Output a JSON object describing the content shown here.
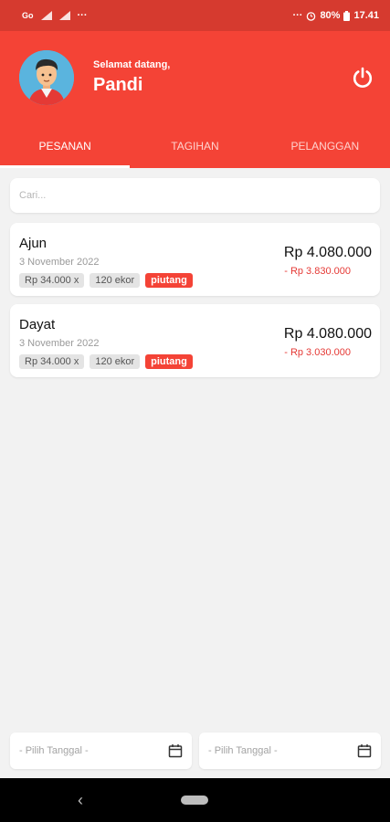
{
  "statusbar": {
    "left_icons": [
      "carrier-icon",
      "signal-icon",
      "signal-icon",
      "more-icon"
    ],
    "right_icons": [
      "more-icon",
      "alarm-icon",
      "battery-icon"
    ],
    "battery": "80%",
    "time": "17.41"
  },
  "header": {
    "greeting": "Selamat datang,",
    "username": "Pandi",
    "logout_icon": "power-icon",
    "avatar_icon": "avatar-icon"
  },
  "tabs": [
    {
      "label": "PESANAN",
      "active": true
    },
    {
      "label": "TAGIHAN",
      "active": false
    },
    {
      "label": "PELANGGAN",
      "active": false
    }
  ],
  "search": {
    "placeholder": "Cari..."
  },
  "orders": [
    {
      "name": "Ajun",
      "date": "3 November 2022",
      "price": "Rp 34.000 x",
      "quantity": "120 ekor",
      "status": "piutang",
      "total": "Rp 4.080.000",
      "remaining": "- Rp 3.830.000"
    },
    {
      "name": "Dayat",
      "date": "3 November 2022",
      "price": "Rp 34.000 x",
      "quantity": "120 ekor",
      "status": "piutang",
      "total": "Rp 4.080.000",
      "remaining": "- Rp 3.030.000"
    }
  ],
  "date_filters": [
    {
      "placeholder": "- Pilih Tanggal -",
      "icon": "calendar-icon"
    },
    {
      "placeholder": "- Pilih Tanggal -",
      "icon": "calendar-icon"
    }
  ],
  "colors": {
    "primary": "#f44336",
    "statusbar": "#d63a2f",
    "accent_red": "#e53935",
    "background": "#f2f2f2"
  }
}
